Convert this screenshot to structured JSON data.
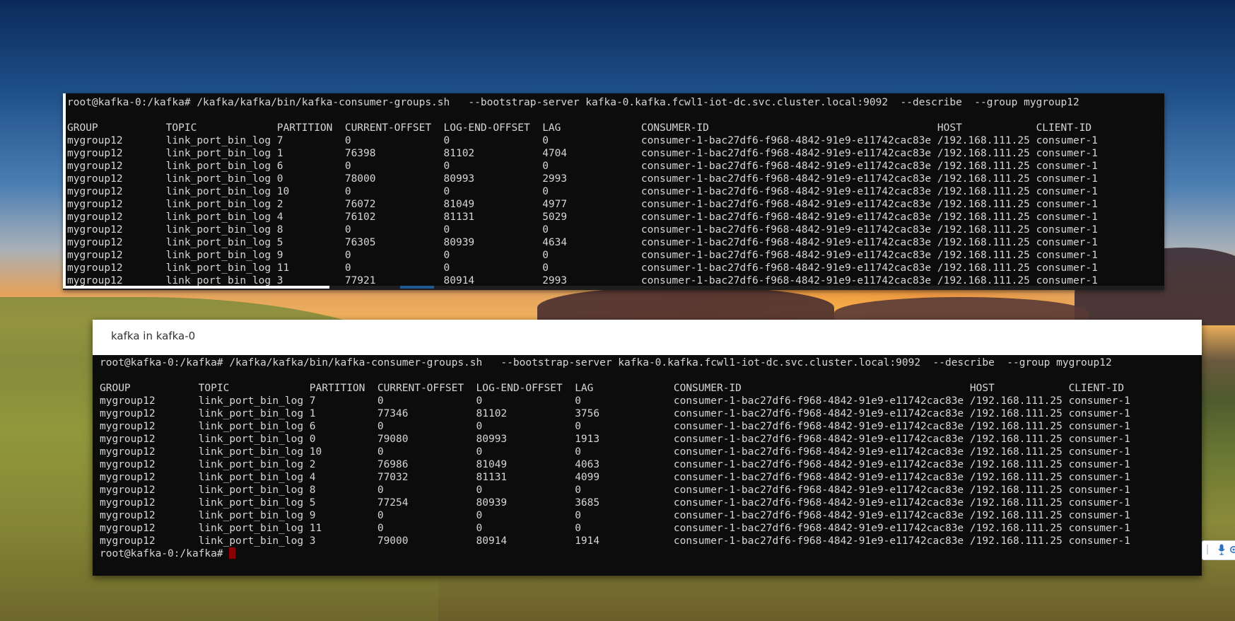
{
  "top_terminal": {
    "command": "root@kafka-0:/kafka# /kafka/kafka/bin/kafka-consumer-groups.sh   --bootstrap-server kafka-0.kafka.fcwl1-iot-dc.svc.cluster.local:9092  --describe  --group mygroup12",
    "header": "GROUP           TOPIC             PARTITION  CURRENT-OFFSET  LOG-END-OFFSET  LAG             CONSUMER-ID                                     HOST            CLIENT-ID",
    "rows": [
      "mygroup12       link_port_bin_log 7          0               0               0               consumer-1-bac27df6-f968-4842-91e9-e11742cac83e /192.168.111.25 consumer-1",
      "mygroup12       link_port_bin_log 1          76398           81102           4704            consumer-1-bac27df6-f968-4842-91e9-e11742cac83e /192.168.111.25 consumer-1",
      "mygroup12       link_port_bin_log 6          0               0               0               consumer-1-bac27df6-f968-4842-91e9-e11742cac83e /192.168.111.25 consumer-1",
      "mygroup12       link_port_bin_log 0          78000           80993           2993            consumer-1-bac27df6-f968-4842-91e9-e11742cac83e /192.168.111.25 consumer-1",
      "mygroup12       link_port_bin_log 10         0               0               0               consumer-1-bac27df6-f968-4842-91e9-e11742cac83e /192.168.111.25 consumer-1",
      "mygroup12       link_port_bin_log 2          76072           81049           4977            consumer-1-bac27df6-f968-4842-91e9-e11742cac83e /192.168.111.25 consumer-1",
      "mygroup12       link_port_bin_log 4          76102           81131           5029            consumer-1-bac27df6-f968-4842-91e9-e11742cac83e /192.168.111.25 consumer-1",
      "mygroup12       link_port_bin_log 8          0               0               0               consumer-1-bac27df6-f968-4842-91e9-e11742cac83e /192.168.111.25 consumer-1",
      "mygroup12       link_port_bin_log 5          76305           80939           4634            consumer-1-bac27df6-f968-4842-91e9-e11742cac83e /192.168.111.25 consumer-1",
      "mygroup12       link_port_bin_log 9          0               0               0               consumer-1-bac27df6-f968-4842-91e9-e11742cac83e /192.168.111.25 consumer-1",
      "mygroup12       link_port_bin_log 11         0               0               0               consumer-1-bac27df6-f968-4842-91e9-e11742cac83e /192.168.111.25 consumer-1",
      "mygroup12       link_port_bin_log 3          77921           80914           2993            consumer-1-bac27df6-f968-4842-91e9-e11742cac83e /192.168.111.25 consumer-1"
    ]
  },
  "bottom_window": {
    "title": "kafka in kafka-0",
    "command": "root@kafka-0:/kafka# /kafka/kafka/bin/kafka-consumer-groups.sh   --bootstrap-server kafka-0.kafka.fcwl1-iot-dc.svc.cluster.local:9092  --describe  --group mygroup12",
    "header": "GROUP           TOPIC             PARTITION  CURRENT-OFFSET  LOG-END-OFFSET  LAG             CONSUMER-ID                                     HOST            CLIENT-ID",
    "rows": [
      "mygroup12       link_port_bin_log 7          0               0               0               consumer-1-bac27df6-f968-4842-91e9-e11742cac83e /192.168.111.25 consumer-1",
      "mygroup12       link_port_bin_log 1          77346           81102           3756            consumer-1-bac27df6-f968-4842-91e9-e11742cac83e /192.168.111.25 consumer-1",
      "mygroup12       link_port_bin_log 6          0               0               0               consumer-1-bac27df6-f968-4842-91e9-e11742cac83e /192.168.111.25 consumer-1",
      "mygroup12       link_port_bin_log 0          79080           80993           1913            consumer-1-bac27df6-f968-4842-91e9-e11742cac83e /192.168.111.25 consumer-1",
      "mygroup12       link_port_bin_log 10         0               0               0               consumer-1-bac27df6-f968-4842-91e9-e11742cac83e /192.168.111.25 consumer-1",
      "mygroup12       link_port_bin_log 2          76986           81049           4063            consumer-1-bac27df6-f968-4842-91e9-e11742cac83e /192.168.111.25 consumer-1",
      "mygroup12       link_port_bin_log 4          77032           81131           4099            consumer-1-bac27df6-f968-4842-91e9-e11742cac83e /192.168.111.25 consumer-1",
      "mygroup12       link_port_bin_log 8          0               0               0               consumer-1-bac27df6-f968-4842-91e9-e11742cac83e /192.168.111.25 consumer-1",
      "mygroup12       link_port_bin_log 5          77254           80939           3685            consumer-1-bac27df6-f968-4842-91e9-e11742cac83e /192.168.111.25 consumer-1",
      "mygroup12       link_port_bin_log 9          0               0               0               consumer-1-bac27df6-f968-4842-91e9-e11742cac83e /192.168.111.25 consumer-1",
      "mygroup12       link_port_bin_log 11         0               0               0               consumer-1-bac27df6-f968-4842-91e9-e11742cac83e /192.168.111.25 consumer-1",
      "mygroup12       link_port_bin_log 3          79000           80914           1914            consumer-1-bac27df6-f968-4842-91e9-e11742cac83e /192.168.111.25 consumer-1"
    ],
    "prompt": "root@kafka-0:/kafka# "
  },
  "tray": {
    "icons": [
      "mic-icon",
      "gear-icon"
    ]
  },
  "colors": {
    "terminal_bg": "#0c0c0c",
    "terminal_fg": "#d6d6d6",
    "cursor": "#8b0000",
    "scroll_accent": "#1f5a94"
  }
}
